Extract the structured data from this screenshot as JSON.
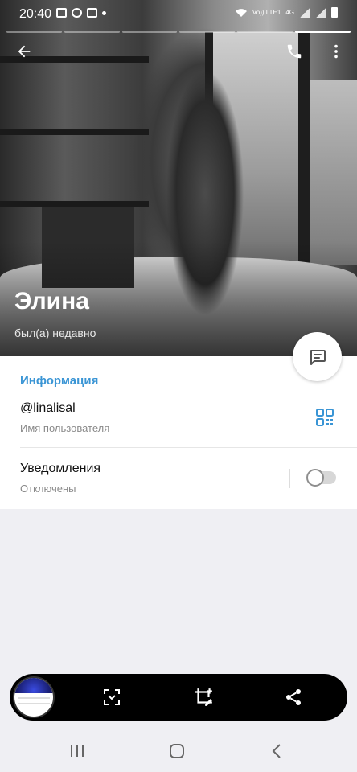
{
  "status_bar": {
    "time": "20:40",
    "network_label": "Vo)) LTE1",
    "network_type": "4G"
  },
  "story_segments": {
    "count": 6,
    "active_index": 5
  },
  "profile": {
    "name": "Элина",
    "last_seen": "был(а) недавно"
  },
  "info": {
    "section_title": "Информация",
    "username": "@linalisal",
    "username_caption": "Имя пользователя",
    "notifications_label": "Уведомления",
    "notifications_status": "Отключены",
    "notifications_enabled": false
  },
  "icons": {
    "back": "arrow-left-icon",
    "call": "phone-icon",
    "more": "more-vertical-icon",
    "qr": "qr-code-icon",
    "message": "message-icon",
    "scan": "scan-icon",
    "crop": "crop-edit-icon",
    "share": "share-icon"
  },
  "colors": {
    "accent": "#3a95d5",
    "background": "#efeff3"
  }
}
